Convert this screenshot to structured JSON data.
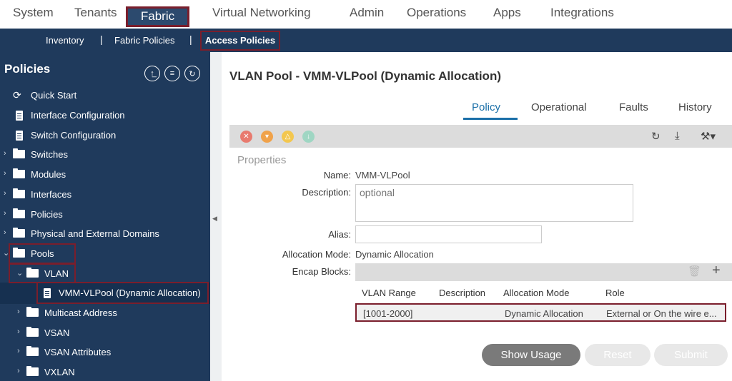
{
  "top_nav": {
    "tabs": [
      "System",
      "Tenants",
      "Fabric",
      "Virtual Networking",
      "Admin",
      "Operations",
      "Apps",
      "Integrations"
    ]
  },
  "sub_nav": {
    "items": [
      "Inventory",
      "Fabric Policies",
      "Access Policies"
    ],
    "separators": [
      "|",
      "|"
    ]
  },
  "sidebar": {
    "title": "Policies",
    "items": [
      {
        "label": "Quick Start",
        "icon": "quick-start-icon"
      },
      {
        "label": "Interface Configuration",
        "icon": "document-icon"
      },
      {
        "label": "Switch Configuration",
        "icon": "document-icon"
      },
      {
        "label": "Switches",
        "icon": "folder-icon"
      },
      {
        "label": "Modules",
        "icon": "folder-icon"
      },
      {
        "label": "Interfaces",
        "icon": "folder-icon"
      },
      {
        "label": "Policies",
        "icon": "folder-icon"
      },
      {
        "label": "Physical and External Domains",
        "icon": "folder-icon"
      },
      {
        "label": "Pools",
        "icon": "folder-icon"
      },
      {
        "label": "VLAN",
        "icon": "folder-icon"
      },
      {
        "label": "VMM-VLPool (Dynamic Allocation)",
        "icon": "document-icon"
      },
      {
        "label": "Multicast Address",
        "icon": "folder-icon"
      },
      {
        "label": "VSAN",
        "icon": "folder-icon"
      },
      {
        "label": "VSAN Attributes",
        "icon": "folder-icon"
      },
      {
        "label": "VXLAN",
        "icon": "folder-icon"
      }
    ]
  },
  "main": {
    "title": "VLAN Pool - VMM-VLPool (Dynamic Allocation)",
    "tabs": [
      "Policy",
      "Operational",
      "Faults",
      "History"
    ],
    "section_title": "Properties",
    "fields": {
      "name_label": "Name:",
      "name_value": "VMM-VLPool",
      "description_label": "Description:",
      "description_placeholder": "optional",
      "alias_label": "Alias:",
      "alias_value": "",
      "allocation_mode_label": "Allocation Mode:",
      "allocation_mode_value": "Dynamic Allocation",
      "encap_blocks_label": "Encap Blocks:"
    },
    "encap_table": {
      "headers": [
        "VLAN Range",
        "Description",
        "Allocation Mode",
        "Role"
      ],
      "rows": [
        [
          "[1001-2000]",
          "",
          "Dynamic Allocation",
          "External or On the wire e..."
        ]
      ]
    },
    "buttons": {
      "show_usage": "Show Usage",
      "reset": "Reset",
      "submit": "Submit"
    }
  },
  "colors": {
    "nav_bg": "#1f3a5c",
    "highlight_border": "#7a1e2c",
    "active_tab": "#1a6fa8",
    "fault_critical": "#e87a6e",
    "fault_major": "#f0a24a",
    "fault_minor": "#f3c74f",
    "fault_warning": "#9fd6c3"
  }
}
